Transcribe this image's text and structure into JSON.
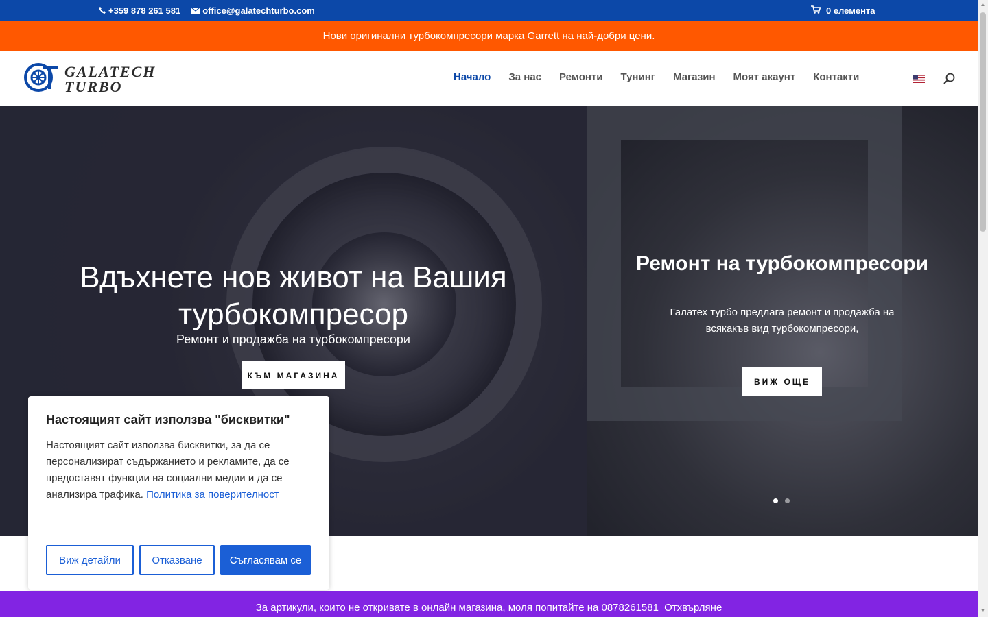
{
  "topbar": {
    "phone": "+359 878 261 581",
    "email": "office@galatechturbo.com",
    "cart": "0 елемента",
    "icons": {
      "phone": "phone-icon",
      "email": "envelope-icon",
      "cart": "cart-icon"
    }
  },
  "promo": {
    "text": "Нови оригинални турбокомпресори марка Garrett на най-добри цени."
  },
  "header": {
    "logo": {
      "line1": "GALATECH",
      "line2": "TURBO"
    },
    "nav": [
      "Начало",
      "За нас",
      "Ремонти",
      "Тунинг",
      "Магазин",
      "Моят акаунт",
      "Контакти"
    ],
    "active_nav": "Начало",
    "language_icon": "us-flag-icon",
    "search_icon": "search-icon"
  },
  "hero": {
    "left": {
      "title": "Вдъхнете нов живот на Вашия турбокомпресор",
      "subtitle": "Ремонт и продажба на турбокомпресори",
      "button": "КЪМ МАГАЗИНА"
    },
    "right": {
      "title": "Ремонт на турбокомпресори",
      "text": "Галатех турбо предлага ремонт и продажба на всякакъв вид турбокомпресори,",
      "button": "ВИЖ ОЩЕ"
    }
  },
  "cookie": {
    "title": "Настоящият сайт използва \"бисквитки\"",
    "text": "Настоящият сайт използва бисквитки, за да се персонализират съдържанието и рекламите, да се предоставят функции на социални медии и да се анализира трафика.",
    "link": "Политика за поверителност",
    "buttons": {
      "details": "Виж детайли",
      "decline": "Отказване",
      "accept": "Съгласявам се"
    }
  },
  "bottom_bar": {
    "text": "За артикули, които не откривате в онлайн магазина, моля попитайте на 0878261581",
    "dismiss": "Отхвърляне"
  },
  "colors": {
    "topbar": "#0c48a8",
    "promo": "#ff5800",
    "accent": "#0c48a8",
    "cookie_button": "#1b5fd6",
    "bottom_bar": "#8224e3"
  }
}
